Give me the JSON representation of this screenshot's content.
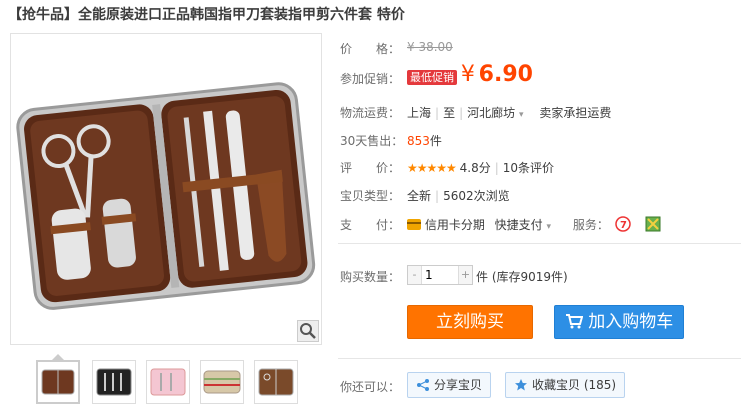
{
  "title": "【抢牛品】全能原装进口正品韩国指甲刀套装指甲剪六件套 特价",
  "price": {
    "label": "价　　格：",
    "value": "¥ 38.00"
  },
  "promo": {
    "label": "参加促销：",
    "tag": "最低促销",
    "yen": "¥",
    "value": "6.90"
  },
  "shipping": {
    "label": "物流运费：",
    "from": "上海",
    "to_prefix": "至",
    "to": "河北廊坊",
    "fee": "卖家承担运费"
  },
  "sold": {
    "label": "30天售出：",
    "count": "853",
    "unit": "件"
  },
  "rating": {
    "label": "评　　价：",
    "stars": "★★★★★",
    "score": "4.8分",
    "reviews": "10条评价"
  },
  "item_type": {
    "label": "宝贝类型：",
    "condition": "全新",
    "views": "5602次浏览"
  },
  "payment": {
    "label": "支　　付：",
    "credit": "信用卡分期",
    "quick": "快捷支付",
    "service_label": "服务："
  },
  "quantity": {
    "label": "购买数量：",
    "value": "1",
    "minus": "-",
    "plus": "+",
    "stock": "件 (库存9019件)"
  },
  "buttons": {
    "buy": "立刻购买",
    "cart": "加入购物车"
  },
  "extra": {
    "label": "你还可以：",
    "share": "分享宝贝",
    "favorite": "收藏宝贝 (185)"
  }
}
